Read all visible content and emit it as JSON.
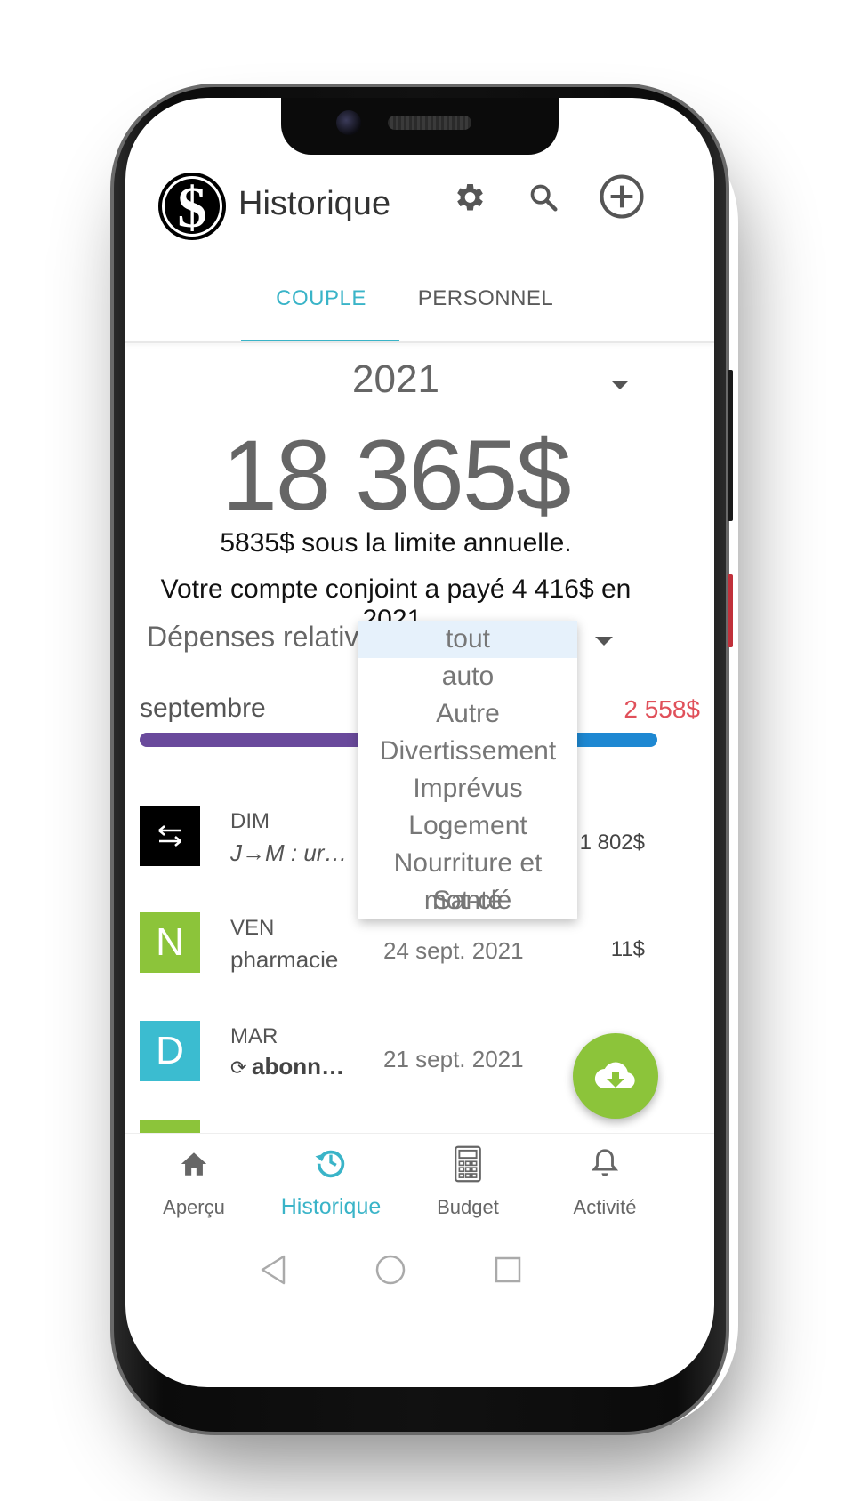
{
  "header": {
    "title": "Historique"
  },
  "tabs": [
    {
      "label": "COUPLE"
    },
    {
      "label": "PERSONNEL"
    }
  ],
  "summary": {
    "year": "2021",
    "total": "18 365$",
    "limit_text": "5835$ sous la limite annuelle.",
    "joint_text": "Votre compte conjoint a payé 4 416$ en 2021.",
    "relative_label": "Dépenses relatives à"
  },
  "month": {
    "label": "septembre",
    "amount": "2 558$"
  },
  "dropdown": {
    "options": [
      "tout",
      "auto",
      "Autre",
      "Divertissement",
      "Imprévus",
      "Logement",
      "Nourriture et Santé",
      "mot-clé"
    ],
    "selected": "tout"
  },
  "transactions": [
    {
      "day": "DIM",
      "desc": "J→M : urge…",
      "date": "",
      "amount": "1 802$",
      "avatar": "⇆",
      "color": "#000000"
    },
    {
      "day": "VEN",
      "desc": "pharmacie",
      "date": "24 sept. 2021",
      "amount": "11$",
      "avatar": "N",
      "color": "#8cc43a"
    },
    {
      "day": "MAR",
      "desc": "abonne…",
      "date": "21 sept. 2021",
      "amount": "",
      "avatar": "D",
      "color": "#3bbcd0"
    }
  ],
  "bottom_nav": [
    {
      "label": "Aperçu",
      "icon": "home-icon"
    },
    {
      "label": "Historique",
      "icon": "history-icon"
    },
    {
      "label": "Budget",
      "icon": "calculator-icon"
    },
    {
      "label": "Activité",
      "icon": "bell-icon"
    }
  ],
  "colors": {
    "accent": "#3ab4c8",
    "fab": "#8cc43a",
    "overspend": "#e0505a"
  }
}
